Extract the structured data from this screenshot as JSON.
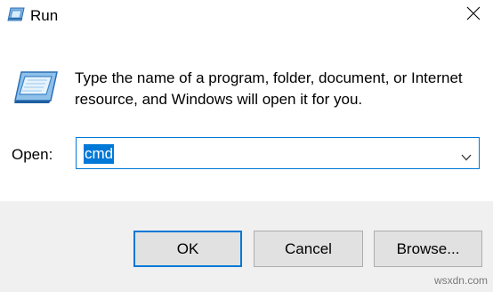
{
  "window": {
    "title": "Run"
  },
  "description": "Type the name of a program, folder, document, or Internet resource, and Windows will open it for you.",
  "open_field": {
    "label": "Open:",
    "value": "cmd"
  },
  "buttons": {
    "ok": "OK",
    "cancel": "Cancel",
    "browse": "Browse..."
  },
  "watermark": "wsxdn.com",
  "icons": {
    "app": "run-icon",
    "close": "close-icon",
    "dropdown": "chevron-down-icon"
  },
  "colors": {
    "accent": "#0078d7",
    "footer_bg": "#f0f0f0",
    "button_bg": "#e1e1e1"
  }
}
